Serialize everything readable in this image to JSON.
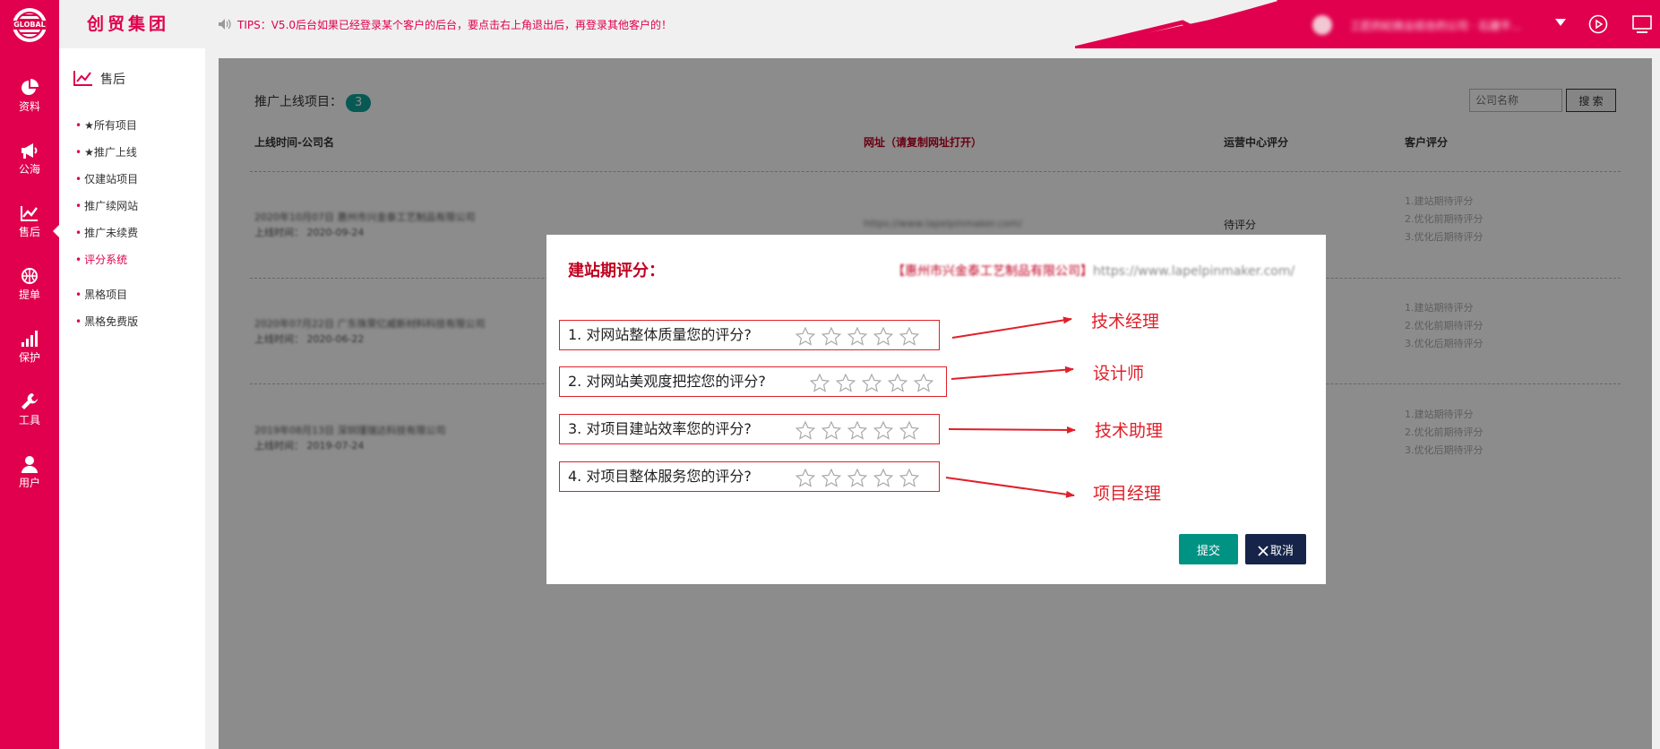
{
  "header": {
    "brand": "创贸集团",
    "logo_text": "GLOBAL",
    "tips": "TIPS：V5.0后台如果已经登录某个客户的后台，要点击右上角退出后，再登录其他客户的！",
    "user_name": "工匠的纪商业综合的公司 · 石建平…",
    "accent_color": "#e0004d",
    "icons": [
      "speaker-icon",
      "caret-down-icon",
      "play-icon",
      "monitor-icon"
    ]
  },
  "rail": {
    "items": [
      {
        "label": "资料",
        "icon": "pie-chart-icon"
      },
      {
        "label": "公海",
        "icon": "megaphone-icon"
      },
      {
        "label": "售后",
        "icon": "line-chart-icon",
        "active": true
      },
      {
        "label": "提单",
        "icon": "basketball-icon"
      },
      {
        "label": "保护",
        "icon": "signal-bars-icon"
      },
      {
        "label": "工具",
        "icon": "wrench-icon"
      },
      {
        "label": "用户",
        "icon": "user-icon"
      }
    ]
  },
  "submenu": {
    "title": "售后",
    "items": [
      {
        "label": "★所有项目"
      },
      {
        "label": "★推广上线"
      },
      {
        "label": "仅建站项目"
      },
      {
        "label": "推广续网站"
      },
      {
        "label": "推广未续费"
      },
      {
        "label": "评分系统",
        "active": true
      },
      {
        "label": "黑格项目"
      },
      {
        "label": "黑格免费版"
      }
    ]
  },
  "panel": {
    "title": "推广上线项目：",
    "count": "3",
    "search_placeholder": "公司名称",
    "search_button": "搜 索",
    "columns": [
      "上线时间-公司名",
      "网址（请复制网址打开）",
      "运营中心评分",
      "客户评分"
    ],
    "rows": [
      {
        "name": "2020年10月07日 惠州市兴金泰工艺制品有限公司",
        "date": "上线时间：  2020-09-24",
        "url": "https://www.lapelpinmaker.com/",
        "status": "待评分",
        "customer": [
          "1.建站期待评分",
          "2.优化前期待评分",
          "3.优化后期待评分"
        ]
      },
      {
        "name": "2020年07月22日 广东珠荣亿威新材料科技有限公司",
        "date": "上线时间：  2020-06-22",
        "url": "",
        "status": "",
        "customer": [
          "1.建站期待评分",
          "2.优化前期待评分",
          "3.优化后期待评分"
        ]
      },
      {
        "name": "2019年08月13日 深圳瑾瑞达科技有限公司",
        "date": "上线时间：  2019-07-24",
        "url": "",
        "status": "",
        "customer": [
          "1.建站期待评分",
          "2.优化前期待评分",
          "3.优化后期待评分"
        ]
      }
    ]
  },
  "modal": {
    "title": "建站期评分：",
    "company": "【惠州市兴金泰工艺制品有限公司】",
    "url": "https://www.lapelpinmaker.com/",
    "questions": [
      {
        "text": "1. 对网站整体质量您的评分?",
        "stars": 0,
        "annotation": "技术经理"
      },
      {
        "text": "2. 对网站美观度把控您的评分?",
        "stars": 0,
        "annotation": "设计师"
      },
      {
        "text": "3. 对项目建站效率您的评分?",
        "stars": 0,
        "annotation": "技术助理"
      },
      {
        "text": "4. 对项目整体服务您的评分?",
        "stars": 0,
        "annotation": "项目经理"
      }
    ],
    "submit_label": "提交",
    "cancel_label": "取消",
    "submit_color": "#009384",
    "cancel_color": "#16244a",
    "annotation_color": "#e0202a"
  }
}
